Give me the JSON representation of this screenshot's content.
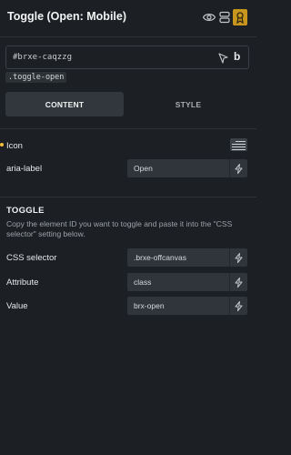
{
  "header": {
    "title": "Toggle (Open: Mobile)",
    "icons": [
      "eye-icon",
      "layers-icon",
      "badge-icon"
    ]
  },
  "selector": {
    "element_id": "#brxe-caqzzg",
    "class_tag": ".toggle-open",
    "icons": [
      "cursor-icon",
      "bold-b-icon"
    ]
  },
  "tabs": [
    {
      "label": "CONTENT",
      "active": true
    },
    {
      "label": "STYLE",
      "active": false
    }
  ],
  "content": {
    "icon_label": "Icon",
    "aria_label": "aria-label",
    "aria_value": "Open"
  },
  "toggle": {
    "title": "TOGGLE",
    "description": "Copy the element ID you want to toggle and paste it into the \"CSS selector\" setting below.",
    "fields": [
      {
        "label": "CSS selector",
        "value": ".brxe-offcanvas"
      },
      {
        "label": "Attribute",
        "value": "class"
      },
      {
        "label": "Value",
        "value": "brx-open"
      }
    ]
  },
  "colors": {
    "background": "#1c1f23",
    "field": "#2f353b",
    "accent_dot": "#f3bf3a",
    "badge": "#c8961c"
  }
}
